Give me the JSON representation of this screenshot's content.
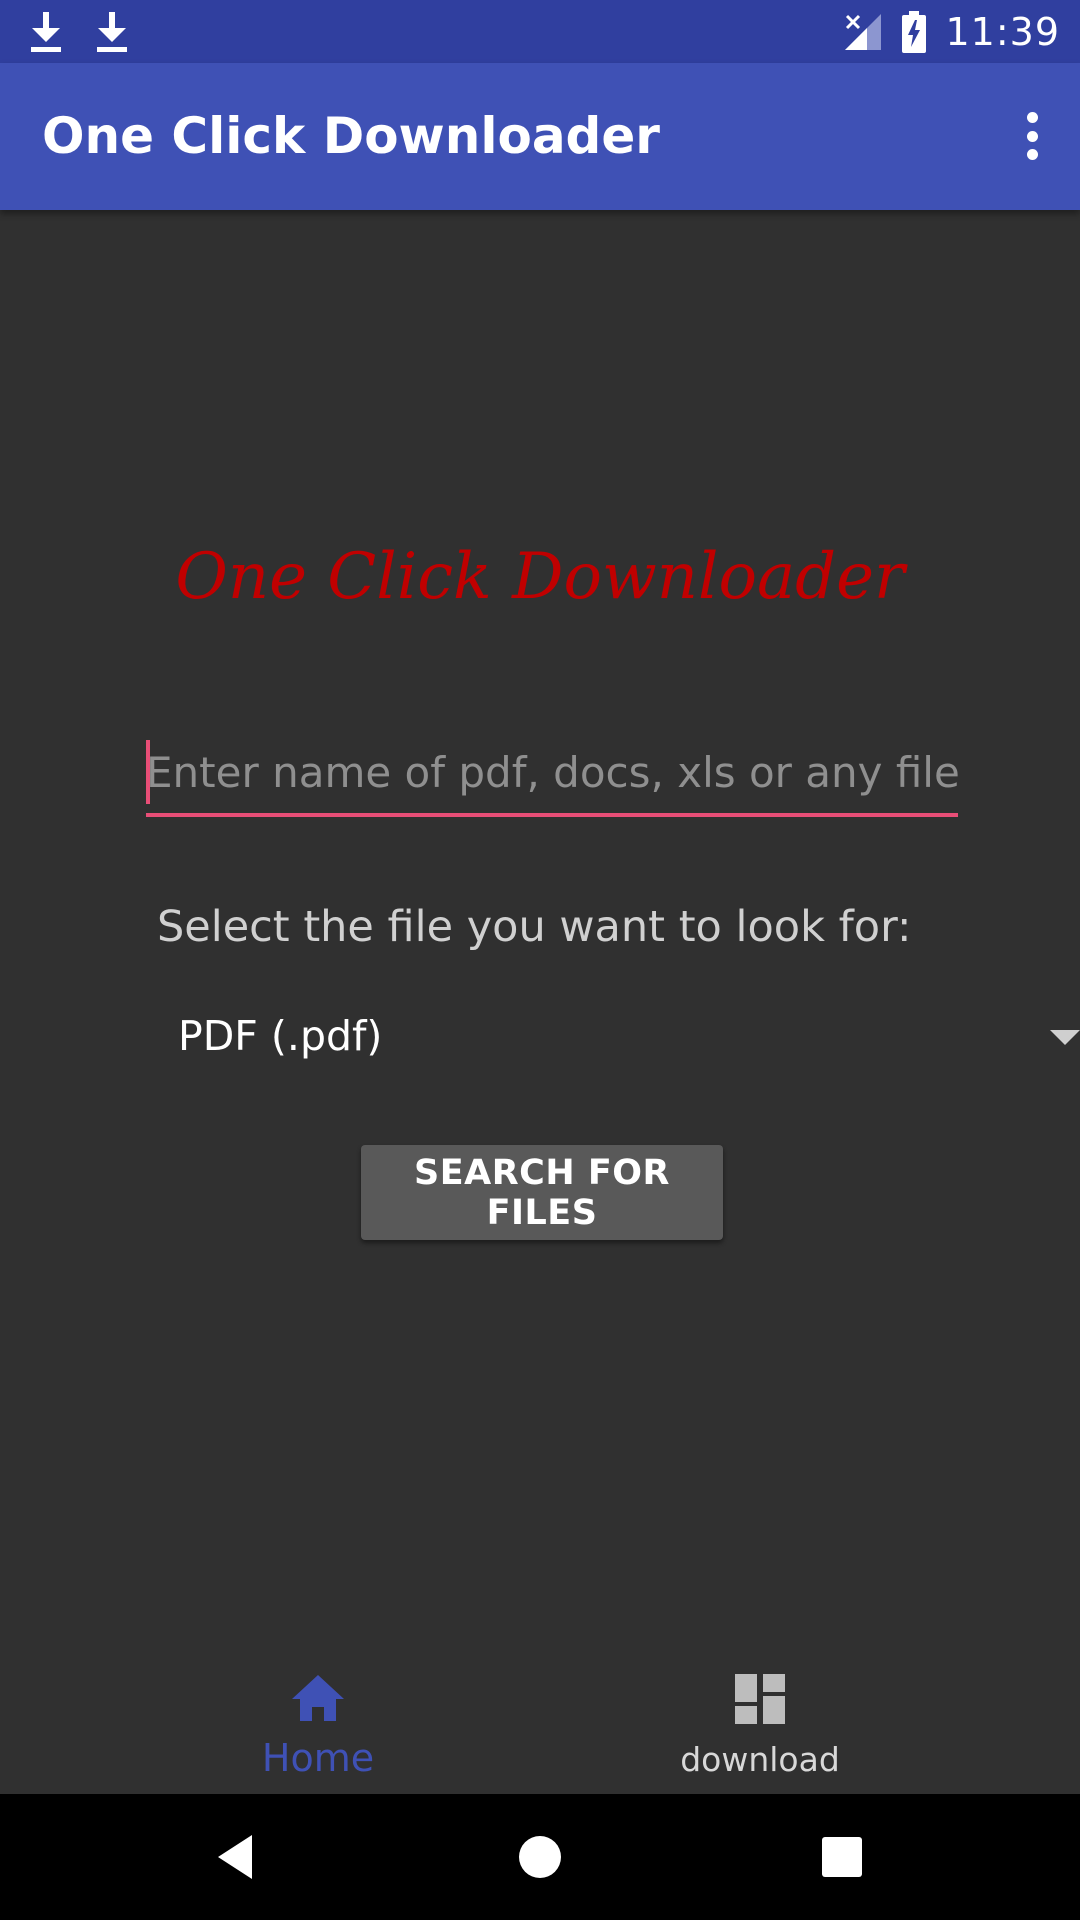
{
  "status_bar": {
    "time": "11:39",
    "left_icons": [
      "download-icon",
      "download-icon"
    ],
    "right_icons": [
      "no-signal-icon",
      "battery-charging-icon"
    ]
  },
  "app_bar": {
    "title": "One Click Downloader",
    "menu_icon": "more-vert-icon"
  },
  "main": {
    "logo_text": "One Click Downloader",
    "search_input": {
      "value": "",
      "placeholder": "Enter name of pdf, docs, xls or any file"
    },
    "select_label": "Select the file you want to look for:",
    "file_type_spinner": {
      "selected": "PDF (.pdf)"
    },
    "search_button_label": "SEARCH FOR FILES"
  },
  "bottom_nav": {
    "items": [
      {
        "label": "Home",
        "icon": "home-icon",
        "active": true
      },
      {
        "label": "download",
        "icon": "dashboard-icon",
        "active": false
      }
    ]
  },
  "system_nav": {
    "buttons": [
      "back-icon",
      "home-circle-icon",
      "recents-icon"
    ]
  },
  "colors": {
    "status_bar": "#303F9F",
    "app_bar": "#3F51B5",
    "background": "#303030",
    "accent": "#E94E77",
    "logo_text": "#C00000",
    "button": "#595959",
    "nav_active": "#3F51B5"
  }
}
